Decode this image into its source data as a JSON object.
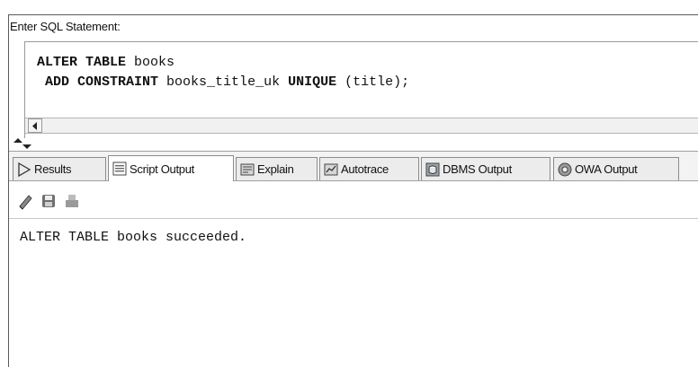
{
  "editor": {
    "label": "Enter SQL Statement:",
    "line1": {
      "kw": "ALTER TABLE",
      "rest": " books"
    },
    "line2": {
      "kw1": "ADD CONSTRAINT",
      "mid": " books_title_uk ",
      "kw2": "UNIQUE",
      "rest": " (title);"
    }
  },
  "tabs": [
    {
      "label": "Results",
      "icon": "play-icon"
    },
    {
      "label": "Script Output",
      "icon": "script-output-icon",
      "active": true
    },
    {
      "label": "Explain",
      "icon": "explain-icon"
    },
    {
      "label": "Autotrace",
      "icon": "autotrace-icon"
    },
    {
      "label": "DBMS Output",
      "icon": "dbms-output-icon"
    },
    {
      "label": "OWA Output",
      "icon": "owa-output-icon"
    }
  ],
  "toolbar": {
    "icons": [
      "eraser-icon",
      "save-icon",
      "print-icon"
    ]
  },
  "output": {
    "text": "ALTER TABLE books succeeded."
  }
}
